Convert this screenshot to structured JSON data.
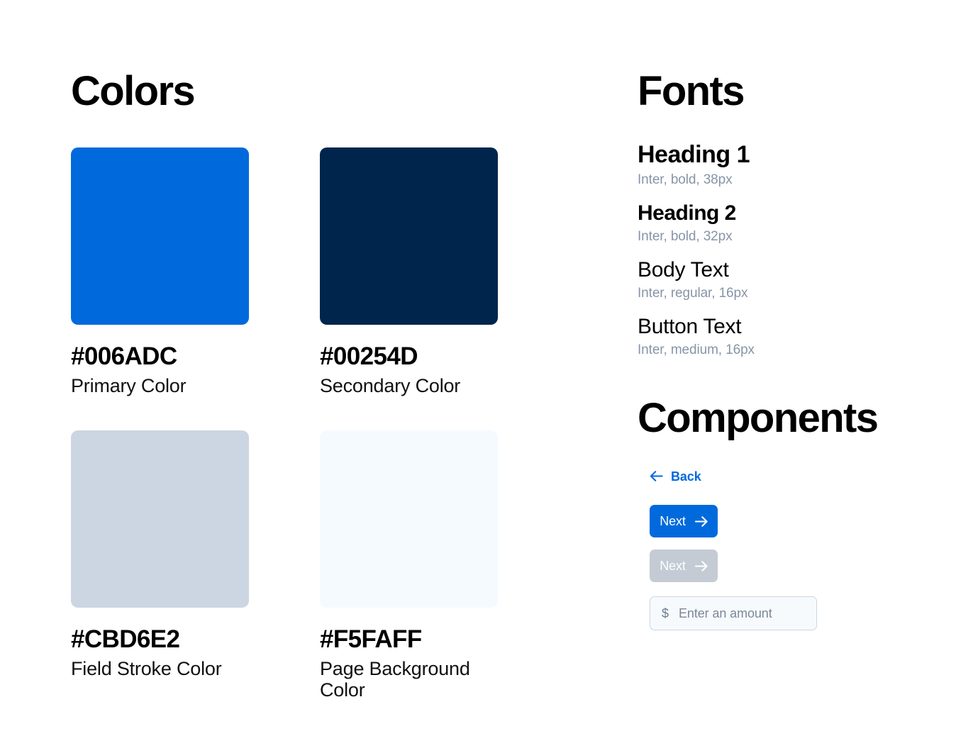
{
  "colors_section": {
    "title": "Colors",
    "swatches": [
      {
        "hex": "#006ADC",
        "name": "Primary Color"
      },
      {
        "hex": "#00254D",
        "name": "Secondary Color"
      },
      {
        "hex": "#CBD6E2",
        "name": "Field Stroke Color"
      },
      {
        "hex": "#F5FAFF",
        "name": "Page Background Color"
      }
    ]
  },
  "fonts_section": {
    "title": "Fonts",
    "styles": [
      {
        "sample": "Heading 1",
        "spec": "Inter, bold, 38px"
      },
      {
        "sample": "Heading 2",
        "spec": "Inter, bold, 32px"
      },
      {
        "sample": "Body Text",
        "spec": "Inter, regular, 16px"
      },
      {
        "sample": "Button Text",
        "spec": "Inter, medium, 16px"
      }
    ],
    "spec_color": "#8795A8"
  },
  "components_section": {
    "title": "Components",
    "back_link": {
      "label": "Back",
      "icon": "arrow-left-icon",
      "color": "#006ADC"
    },
    "primary_button": {
      "label": "Next",
      "icon": "arrow-right-icon",
      "background": "#006ADC",
      "text_color": "#FFFFFF"
    },
    "disabled_button": {
      "label": "Next",
      "icon": "arrow-right-icon",
      "background": "#C4CBD4",
      "text_color": "#FFFFFF"
    },
    "amount_input": {
      "currency_symbol": "$",
      "placeholder": "Enter an amount",
      "value": "",
      "background": "#F7FAFD",
      "border_color": "#CBD6E2"
    }
  }
}
